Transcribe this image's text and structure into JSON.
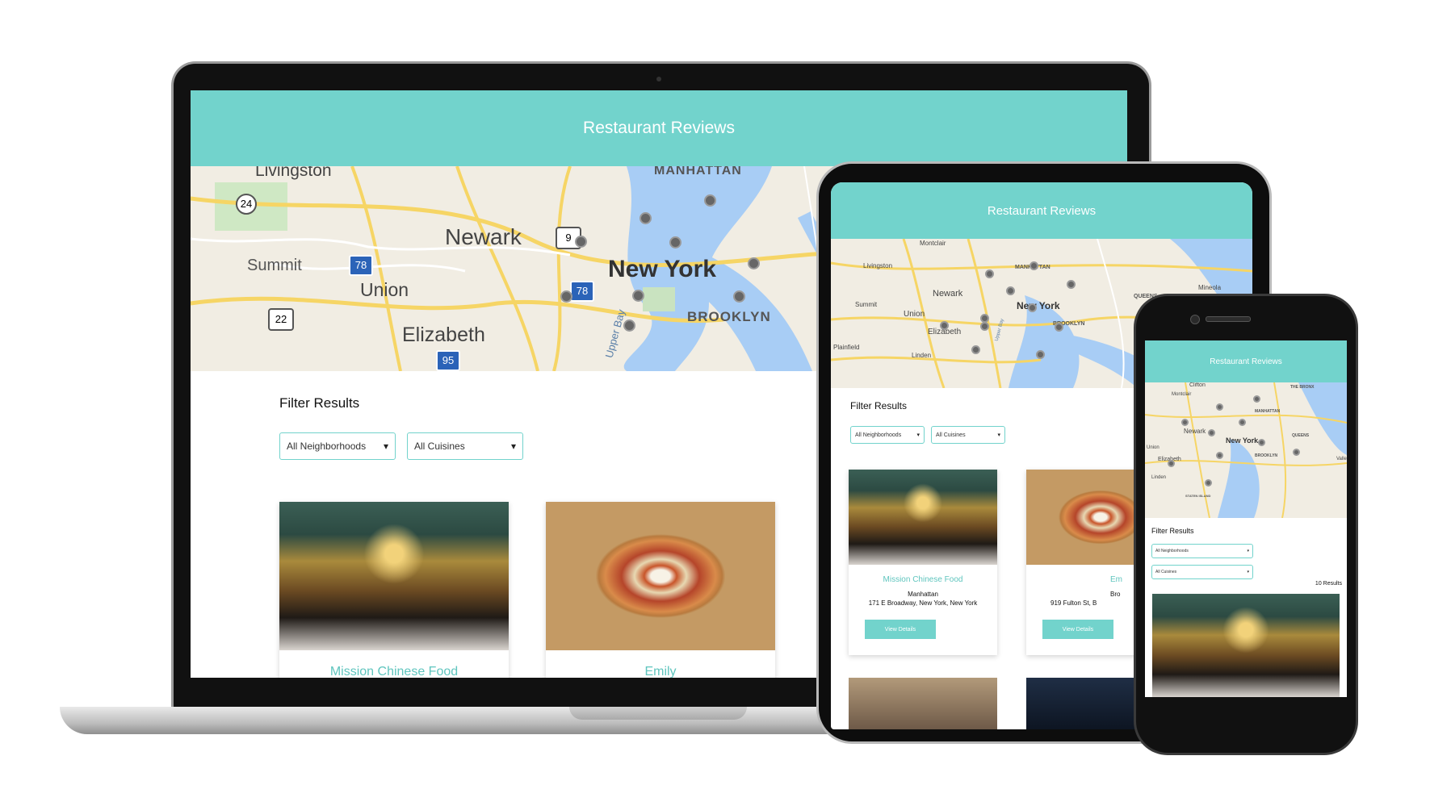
{
  "app_title": "Restaurant Reviews",
  "laptop": {
    "map_labels": {
      "livingston": "Livingston",
      "manhattan": "MANHATTAN",
      "newark": "Newark",
      "summit": "Summit",
      "union": "Union",
      "new_york": "New York",
      "brooklyn": "BROOKLYN",
      "elizabeth": "Elizabeth",
      "upper_bay": "Upper Bay",
      "shield_24": "24",
      "shield_78a": "78",
      "shield_78b": "78",
      "shield_9": "9",
      "shield_22": "22",
      "shield_95": "95"
    },
    "filter_heading": "Filter Results",
    "neighborhood_select": "All Neighborhoods",
    "cuisine_select": "All Cuisines",
    "cards": [
      {
        "name": "Mission Chinese Food"
      },
      {
        "name": "Emily"
      }
    ]
  },
  "tablet": {
    "map_labels": {
      "montclair": "Montclair",
      "livingston": "Livingston",
      "manhattan": "MANHATTAN",
      "newark": "Newark",
      "summit": "Summit",
      "union": "Union",
      "new_york": "New York",
      "queens": "QUEENS",
      "brooklyn": "BROOKLYN",
      "elizabeth": "Elizabeth",
      "plainfield": "Plainfield",
      "linden": "Linden",
      "mineola": "Mineola",
      "upper_bay": "Upper Bay"
    },
    "filter_heading": "Filter Results",
    "neighborhood_select": "All Neighborhoods",
    "cuisine_select": "All Cuisines",
    "cards": [
      {
        "name": "Mission Chinese Food",
        "neighborhood": "Manhattan",
        "address": "171 E Broadway, New York, New York",
        "button": "View Details"
      },
      {
        "name": "Em",
        "neighborhood": "Bro",
        "address": "919 Fulton St, B",
        "button": "View Details"
      }
    ]
  },
  "phone": {
    "map_labels": {
      "clifton": "Clifton",
      "montclair": "Montclair",
      "the_bronx": "THE BRONX",
      "manhattan": "MANHATTAN",
      "newark": "Newark",
      "new_york": "New York",
      "queens": "QUEENS",
      "union": "Union",
      "brooklyn": "BROOKLYN",
      "elizabeth": "Elizabeth",
      "linden": "Linden",
      "staten_island": "STATEN ISLAND",
      "valley": "Valle"
    },
    "filter_heading": "Filter Results",
    "neighborhood_select": "All Neighborhoods",
    "cuisine_select": "All Cuisines",
    "results_count": "10 Results"
  },
  "colors": {
    "accent": "#72d3cc",
    "accent_text": "#5fc5be"
  },
  "icons": {
    "caret": "▾"
  }
}
